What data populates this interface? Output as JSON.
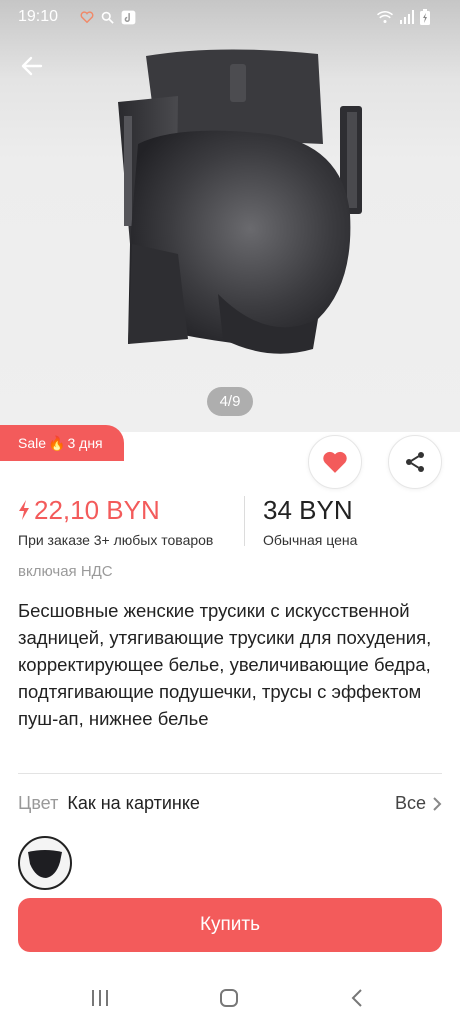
{
  "status_bar": {
    "time": "19:10"
  },
  "gallery": {
    "page_counter": "4/9",
    "image_alt": "product-photo-shapewear"
  },
  "sale_badge": {
    "label": "Sale",
    "icon": "fire-icon",
    "duration": "3 дня"
  },
  "price": {
    "sale_price": "22,10 BYN",
    "sale_note": "При заказе 3+ любых товаров",
    "regular_price": "34 BYN",
    "regular_note": "Обычная цена",
    "vat_note": "включая НДС"
  },
  "product": {
    "title": "Бесшовные женские трусики с искусственной задницей, утягивающие трусики для похудения, корректирующее белье, увеличивающие бедра, подтягивающие подушечки, трусы с эффектом пуш-ап, нижнее белье"
  },
  "color": {
    "label": "Цвет",
    "value": "Как на картинке",
    "all_label": "Все"
  },
  "buy_button": {
    "label": "Купить"
  },
  "colors": {
    "accent": "#f35b5b",
    "text": "#222222",
    "muted": "#999999"
  }
}
